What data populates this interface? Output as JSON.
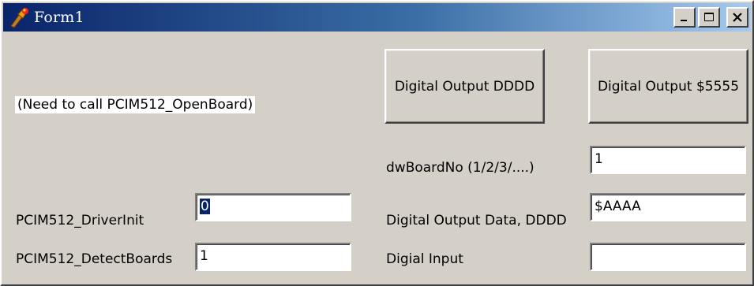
{
  "window": {
    "title": "Form1",
    "icons": {
      "app": "torch-icon",
      "minimize": "minimize-icon",
      "maximize": "maximize-icon",
      "close": "close-icon"
    }
  },
  "note": "(Need to call PCIM512_OpenBoard)",
  "buttons": {
    "output_dddd": "Digital Output DDDD",
    "output_5555": "Digital Output $5555"
  },
  "fields": {
    "driver_init": {
      "label": "PCIM512_DriverInit",
      "value": "0"
    },
    "detect_boards": {
      "label": "PCIM512_DetectBoards",
      "value": "1"
    },
    "board_no": {
      "label": "dwBoardNo  (1/2/3/....)",
      "value": "1"
    },
    "output_data": {
      "label": "Digital Output Data, DDDD",
      "value": "$AAAA"
    },
    "digital_input": {
      "label": "Digial Input",
      "value": ""
    }
  },
  "colors": {
    "face": "#d4d0c8",
    "title_start": "#0a246a",
    "title_end": "#a6caf0",
    "selection": "#0a246a"
  }
}
